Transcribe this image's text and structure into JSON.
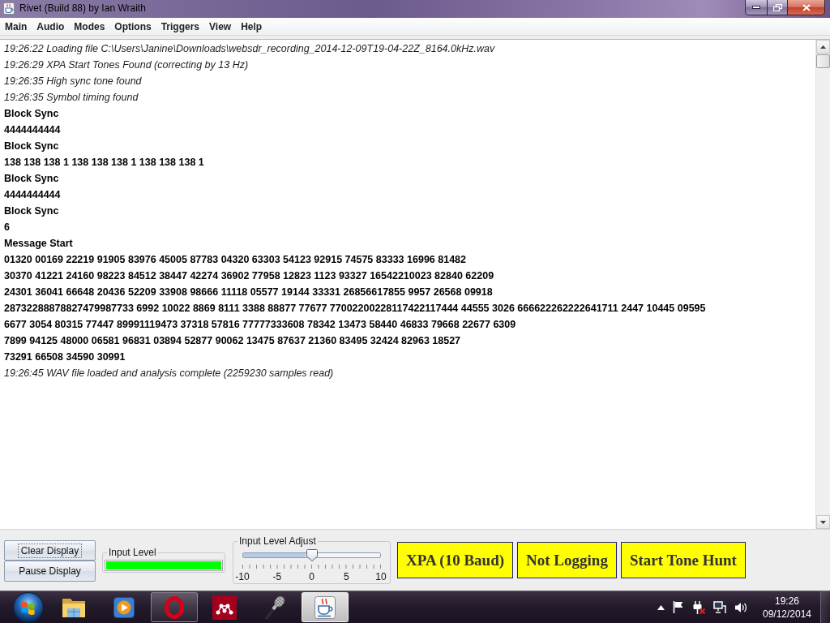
{
  "window": {
    "title": "Rivet (Build 88) by Ian Wraith"
  },
  "menu": [
    "Main",
    "Audio",
    "Modes",
    "Options",
    "Triggers",
    "View",
    "Help"
  ],
  "log": [
    {
      "kind": "status",
      "text": "19:26:22 Loading file C:\\Users\\Janine\\Downloads\\websdr_recording_2014-12-09T19-04-22Z_8164.0kHz.wav"
    },
    {
      "kind": "status",
      "text": "19:26:29 XPA Start Tones Found (correcting by 13 Hz)"
    },
    {
      "kind": "status",
      "text": "19:26:35 High sync tone found"
    },
    {
      "kind": "status",
      "text": "19:26:35 Symbol timing found"
    },
    {
      "kind": "data",
      "text": "Block Sync"
    },
    {
      "kind": "data",
      "text": "4444444444"
    },
    {
      "kind": "data",
      "text": "Block Sync"
    },
    {
      "kind": "data",
      "text": "138 138 138 1 138 138 138 1 138 138 138 1"
    },
    {
      "kind": "data",
      "text": "Block Sync"
    },
    {
      "kind": "data",
      "text": "4444444444"
    },
    {
      "kind": "data",
      "text": "Block Sync"
    },
    {
      "kind": "data",
      "text": "6"
    },
    {
      "kind": "data",
      "text": "Message Start"
    },
    {
      "kind": "data",
      "text": "01320 00169 22219 91905 83976 45005 87783 04320 63303 54123 92915 74575 83333 16996 81482"
    },
    {
      "kind": "data",
      "text": "30370 41221 24160 98223 84512 38447 42274 36902 77958 12823 1123 93327 16542210023 82840 62209"
    },
    {
      "kind": "data",
      "text": "24301 36041 66648 20436 52209 33908 98666 11118 05577 19144 33331 26856617855 9957 26568 09918"
    },
    {
      "kind": "data",
      "text": "28732288878827479987733 6992 10022 8869 8111 3388 88877 77677 77002200228117422117444 44555 3026 666622262222641711 2447 10445 09595"
    },
    {
      "kind": "data",
      "text": "6677 3054 80315 77447 89991119473 37318 57816 77777333608 78342 13473 58440 46833 79668 22677 6309"
    },
    {
      "kind": "data",
      "text": "7899 94125 48000 06581 96831 03894 52877 90062 13475 87637 21360 83495 32424 82963 18527"
    },
    {
      "kind": "data",
      "text": "73291 66508 34590 30991"
    },
    {
      "kind": "status",
      "text": "19:26:45 WAV file loaded and analysis complete (2259230 samples read)"
    }
  ],
  "controls": {
    "buttons": [
      {
        "label": "Clear Display",
        "focused": true
      },
      {
        "label": "Pause Display",
        "focused": false
      }
    ],
    "input_level": {
      "title": "Input Level",
      "level": 1
    },
    "input_level_adjust": {
      "title": "Input Level Adjust",
      "level": 0.5,
      "tick_labels": [
        "-10",
        "-5",
        "0",
        "5",
        "10"
      ]
    },
    "status_buttons": [
      "XPA (10 Baud)",
      "Not Logging",
      "Start Tone Hunt"
    ]
  },
  "taskbar": {
    "apps": [
      {
        "kind": "folder",
        "running": false,
        "selected": false
      },
      {
        "kind": "player",
        "running": false,
        "selected": false
      },
      {
        "kind": "ring",
        "running": true,
        "selected": false
      },
      {
        "kind": "dots",
        "running": false,
        "selected": false
      },
      {
        "kind": "microphone",
        "running": false,
        "selected": false
      },
      {
        "kind": "cup",
        "running": true,
        "selected": true
      }
    ],
    "clock": {
      "time": "19:26",
      "date": "09/12/2014"
    }
  }
}
